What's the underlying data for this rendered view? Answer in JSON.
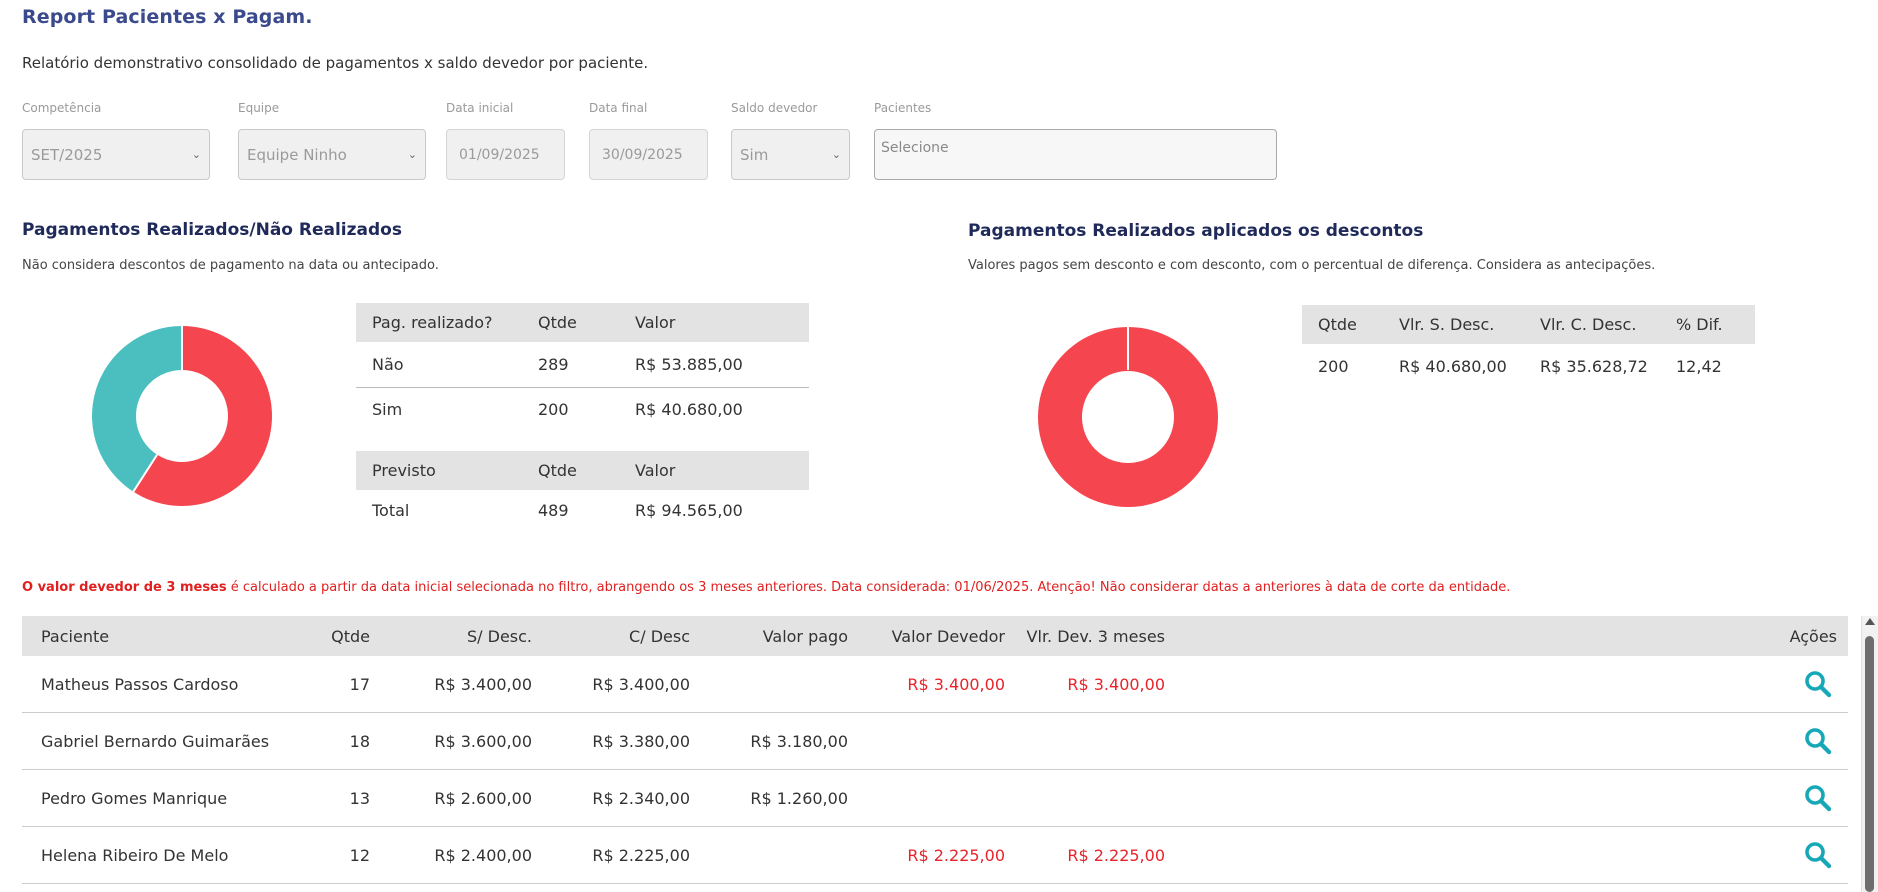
{
  "header": {
    "title": "Report Pacientes x Pagam.",
    "subtitle": "Relatório demonstrativo consolidado de pagamentos x saldo devedor por paciente."
  },
  "filters": {
    "competencia": {
      "label": "Competência",
      "value": "SET/2025"
    },
    "equipe": {
      "label": "Equipe",
      "value": "Equipe Ninho"
    },
    "data_inicial": {
      "label": "Data inicial",
      "value": "01/09/2025"
    },
    "data_final": {
      "label": "Data final",
      "value": "30/09/2025"
    },
    "saldo_devedor": {
      "label": "Saldo devedor",
      "value": "Sim"
    },
    "pacientes": {
      "label": "Pacientes",
      "placeholder": "Selecione"
    }
  },
  "left_section": {
    "title": "Pagamentos Realizados/Não Realizados",
    "subtitle": "Não considera descontos de pagamento na data ou antecipado.",
    "table": {
      "headers": [
        "Pag. realizado?",
        "Qtde",
        "Valor"
      ],
      "rows": [
        [
          "Não",
          "289",
          "R$ 53.885,00"
        ],
        [
          "Sim",
          "200",
          "R$ 40.680,00"
        ]
      ]
    },
    "previsto_table": {
      "headers": [
        "Previsto",
        "Qtde",
        "Valor"
      ],
      "rows": [
        [
          "Total",
          "489",
          "R$ 94.565,00"
        ]
      ]
    },
    "donut": {
      "nao": 289,
      "sim": 200,
      "colors": {
        "nao": "#f5454f",
        "sim": "#4bbfbf"
      }
    }
  },
  "right_section": {
    "title": "Pagamentos Realizados aplicados os descontos",
    "subtitle": "Valores pagos sem desconto e com desconto, com o percentual de diferença. Considera as antecipações.",
    "table": {
      "headers": [
        "Qtde",
        "Vlr. S. Desc.",
        "Vlr. C. Desc.",
        "% Dif."
      ],
      "rows": [
        [
          "200",
          "R$ 40.680,00",
          "R$ 35.628,72",
          "12,42"
        ]
      ]
    },
    "donut": {
      "color": "#f5454f"
    }
  },
  "warning": {
    "bold": "O valor devedor de 3 meses",
    "rest": " é calculado a partir da data inicial selecionada no filtro, abrangendo os 3 meses anteriores. Data considerada: 01/06/2025. Atenção! Não considerar datas a anteriores à data de corte da entidade."
  },
  "patients_table": {
    "headers": {
      "paciente": "Paciente",
      "qtde": "Qtde",
      "s_desc": "S/ Desc.",
      "c_desc": "C/ Desc",
      "valor_pago": "Valor pago",
      "valor_devedor": "Valor Devedor",
      "vlr_dev_3m": "Vlr. Dev. 3 meses",
      "acoes": "Ações"
    },
    "rows": [
      {
        "paciente": "Matheus Passos Cardoso",
        "qtde": "17",
        "s_desc": "R$ 3.400,00",
        "c_desc": "R$ 3.400,00",
        "valor_pago": "",
        "valor_devedor": "R$ 3.400,00",
        "vlr_dev_3m": "R$ 3.400,00"
      },
      {
        "paciente": "Gabriel Bernardo Guimarães",
        "qtde": "18",
        "s_desc": "R$ 3.600,00",
        "c_desc": "R$ 3.380,00",
        "valor_pago": "R$ 3.180,00",
        "valor_devedor": "",
        "vlr_dev_3m": ""
      },
      {
        "paciente": "Pedro Gomes Manrique",
        "qtde": "13",
        "s_desc": "R$ 2.600,00",
        "c_desc": "R$ 2.340,00",
        "valor_pago": "R$ 1.260,00",
        "valor_devedor": "",
        "vlr_dev_3m": ""
      },
      {
        "paciente": "Helena Ribeiro De Melo",
        "qtde": "12",
        "s_desc": "R$ 2.400,00",
        "c_desc": "R$ 2.225,00",
        "valor_pago": "",
        "valor_devedor": "R$ 2.225,00",
        "vlr_dev_3m": "R$ 2.225,00"
      }
    ]
  },
  "colors": {
    "title": "#3a4a8c",
    "section_title": "#1f2a5a",
    "danger": "#e8232a",
    "action_icon": "#17a8b8"
  },
  "icons": {
    "row_action": "search-icon",
    "select": "chevron-down-icon"
  }
}
